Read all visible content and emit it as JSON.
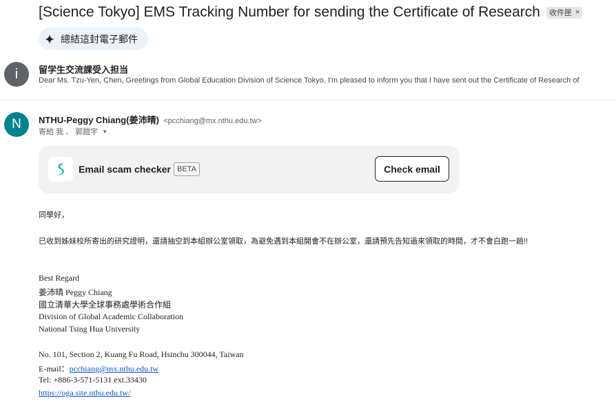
{
  "header": {
    "subject": "[Science Tokyo] EMS Tracking Number for sending the Certificate of Research",
    "label_chip": "收件匣",
    "label_chip_close": "×",
    "summarize_label": "總結這封電子郵件"
  },
  "collapsed_message": {
    "avatar_letter": "i",
    "sender": "留学生交流課受入担当",
    "snippet": "Dear Ms. Tzu-Yen, Chen, Greetings from Global Education Division of Science Tokyo. I'm pleased to inform you that I have sent out the Certificate of Research of"
  },
  "open_message": {
    "avatar_letter": "N",
    "sender_name": "NTHU-Peggy Chiang(姜沛晴)",
    "sender_email": "<pcchiang@mx.nthu.edu.tw>",
    "recipients": "寄給 我 、 郭鎧宇",
    "scam_checker": {
      "title": "Email scam checker",
      "badge": "BETA",
      "button": "Check email"
    },
    "greeting": "同學好，",
    "paragraph": "已收到姊妹校所寄出的研究證明，還請抽空到本組辦公室領取，為避免遇到本組開會不在辦公室，還請預先告知過來領取的時間，才不會白跑一趟!!",
    "signature": {
      "closing": "Best Regard",
      "name": "姜沛晴 Peggy Chiang",
      "office_zh": "國立清華大學全球事務處學術合作組",
      "division": "Division of Global Academic Collaboration",
      "university": "National Tsing Hua University",
      "address": "No. 101, Section 2, Kuang Fu Road, Hsinchu 300044, Taiwan",
      "email_label": "E-mail：",
      "email": "pcchiang@mx.nthu.edu.tw",
      "tel": "Tel: +886-3-571-5131 ext.33430",
      "website": "https://oga.site.nthu.edu.tw/"
    }
  },
  "colors": {
    "summarize_bg": "#edf2fa",
    "avatar_gray": "#5f6368",
    "avatar_teal": "#00838f",
    "surfshark_teal": "#1eb6a6",
    "link": "#1155cc"
  },
  "icons": [
    "sparkle-icon",
    "close-icon",
    "chevron-down-icon",
    "surfshark-logo-icon"
  ]
}
